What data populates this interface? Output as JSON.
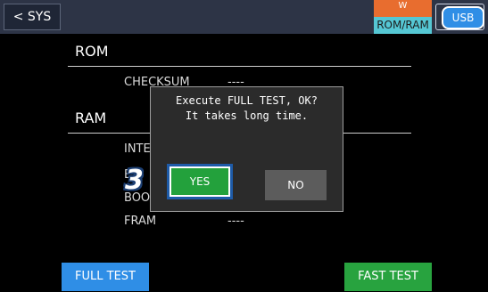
{
  "topbar": {
    "back_label": "< SYS",
    "memory_mode_top": "W",
    "memory_mode_bottom": "ROM/RAM",
    "usb_label": "USB"
  },
  "rom": {
    "title": "ROM",
    "rows": [
      {
        "label": "CHECKSUM",
        "value": "----"
      }
    ]
  },
  "ram": {
    "title": "RAM",
    "rows": [
      {
        "label": "INTE",
        "value": ""
      },
      {
        "label": "EX",
        "value": ""
      },
      {
        "label": "BOO",
        "value": ""
      },
      {
        "label": "FRAM",
        "value": "----"
      }
    ]
  },
  "dialog": {
    "line1": "Execute FULL TEST, OK?",
    "line2": "It takes long time.",
    "yes_label": "YES",
    "no_label": "NO"
  },
  "step_marker": "3",
  "bottom": {
    "full_test_label": "FULL TEST",
    "fast_test_label": "FAST TEST"
  },
  "colors": {
    "topbar": "#2d3446",
    "blue_button": "#2f8ee6",
    "green_button": "#28a33f",
    "memory_orange": "#e86d2f",
    "memory_cyan": "#55c7d4"
  }
}
